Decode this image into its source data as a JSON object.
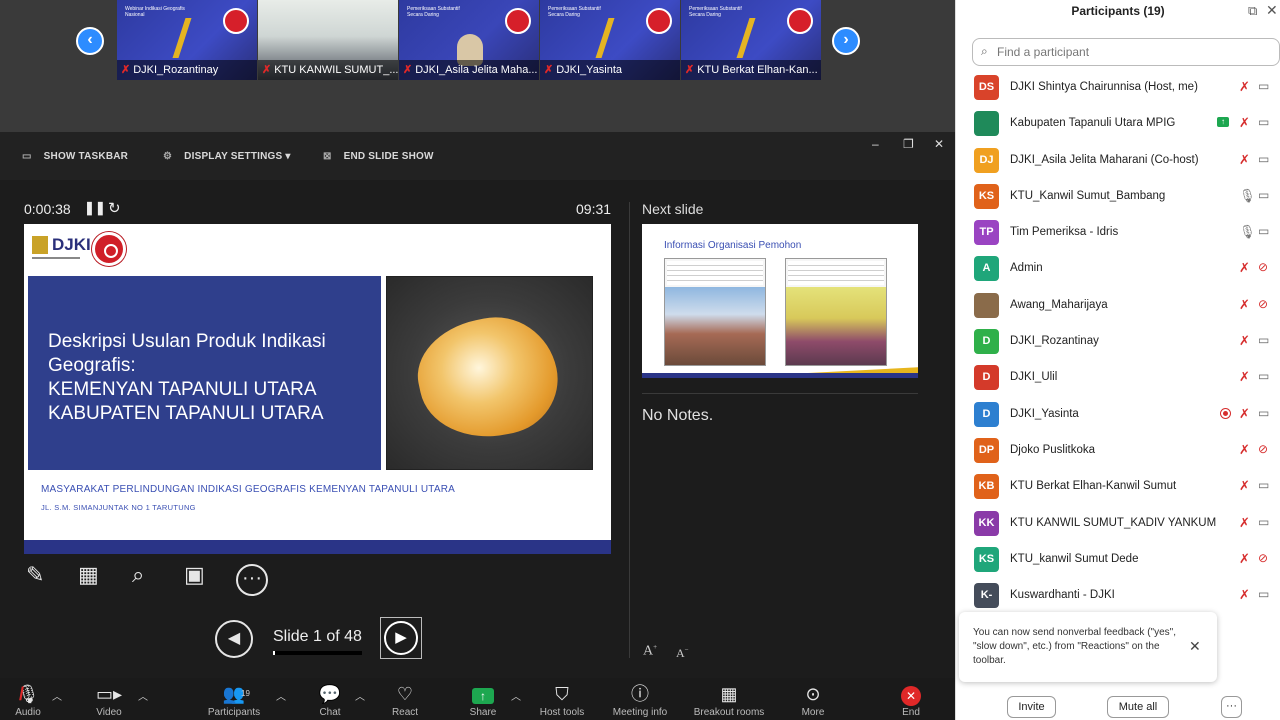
{
  "gallery": {
    "prev_icon": "‹",
    "next_icon": "›",
    "tiles": [
      {
        "name": "DJKI_Rozantinay",
        "kind": "slide",
        "caption": "Webinar Indikasi Geografis Nasional"
      },
      {
        "name": "KTU KANWIL SUMUT_...",
        "kind": "photo",
        "caption": ""
      },
      {
        "name": "DJKI_Asila Jelita Maha...",
        "kind": "person",
        "caption": "Pemeriksaan Substantif Secara Daring"
      },
      {
        "name": "DJKI_Yasinta",
        "kind": "slide",
        "caption": "Pemeriksaan Substantif Secara Daring"
      },
      {
        "name": "KTU Berkat Elhan-Kan...",
        "kind": "slide",
        "caption": "Pemeriksaan Substantif Secara Daring"
      }
    ]
  },
  "slideshow_toolbar": {
    "show_taskbar": "SHOW TASKBAR",
    "display_settings": "DISPLAY SETTINGS ▾",
    "end_slide_show": "END SLIDE SHOW"
  },
  "presenter": {
    "elapsed": "0:00:38",
    "clock": "09:31",
    "next_slide_label": "Next slide",
    "no_notes": "No Notes.",
    "slide_counter": "Slide 1 of 48",
    "progress_fraction": 0.0208
  },
  "slide": {
    "logo_text": "DJKI",
    "title_lines": [
      "Deskripsi Usulan Produk Indikasi",
      "Geografis:",
      "KEMENYAN TAPANULI UTARA",
      "KABUPATEN TAPANULI UTARA"
    ],
    "footer_line1": "MASYARAKAT PERLINDUNGAN INDIKASI GEOGRAFIS KEMENYAN TAPANULI UTARA",
    "footer_line2": "JL. S.M. SIMANJUNTAK NO 1 TARUTUNG"
  },
  "next_slide": {
    "title": "Informasi Organisasi Pemohon"
  },
  "bottom_toolbar": {
    "audio": "Audio",
    "video": "Video",
    "participants": "Participants",
    "participants_count": "19",
    "chat": "Chat",
    "react": "React",
    "share": "Share",
    "host_tools": "Host tools",
    "meeting_info": "Meeting info",
    "breakout_rooms": "Breakout rooms",
    "more": "More",
    "end": "End"
  },
  "panel": {
    "title": "Participants (19)",
    "search_placeholder": "Find a participant",
    "participants": [
      {
        "initials": "DS",
        "name": "DJKI Shintya Chairunnisa (Host, me)",
        "color": "#d9432a",
        "mic": "muted",
        "cam": "on"
      },
      {
        "initials": "",
        "name": "Kabupaten Tapanuli Utara MPIG",
        "color": "#1f8a5a",
        "mic": "muted",
        "cam": "on",
        "sharing": true
      },
      {
        "initials": "DJ",
        "name": "DJKI_Asila Jelita Maharani (Co-host)",
        "color": "#f0a020",
        "mic": "muted",
        "cam": "on"
      },
      {
        "initials": "KS",
        "name": "KTU_Kanwil Sumut_Bambang",
        "color": "#e0621a",
        "mic": "on",
        "cam": "on"
      },
      {
        "initials": "TP",
        "name": "Tim Pemeriksa - Idris",
        "color": "#9a44c2",
        "mic": "on",
        "cam": "on"
      },
      {
        "initials": "A",
        "name": "Admin",
        "color": "#1fa67a",
        "mic": "muted",
        "cam": "off"
      },
      {
        "initials": "",
        "name": "Awang_Maharijaya",
        "color": "#8a6b4a",
        "mic": "muted",
        "cam": "off"
      },
      {
        "initials": "D",
        "name": "DJKI_Rozantinay",
        "color": "#2fb04a",
        "mic": "muted",
        "cam": "on"
      },
      {
        "initials": "D",
        "name": "DJKI_Ulil",
        "color": "#d43a2a",
        "mic": "muted",
        "cam": "on"
      },
      {
        "initials": "D",
        "name": "DJKI_Yasinta",
        "color": "#2d7fd0",
        "mic": "muted",
        "cam": "on",
        "recording": true
      },
      {
        "initials": "DP",
        "name": "Djoko Puslitkoka",
        "color": "#e0621a",
        "mic": "muted",
        "cam": "off"
      },
      {
        "initials": "KB",
        "name": "KTU Berkat Elhan-Kanwil Sumut",
        "color": "#e0621a",
        "mic": "muted",
        "cam": "on"
      },
      {
        "initials": "KK",
        "name": "KTU KANWIL SUMUT_KADIV YANKUM",
        "color": "#8a3aa8",
        "mic": "muted",
        "cam": "on"
      },
      {
        "initials": "KS",
        "name": "KTU_kanwil Sumut Dede",
        "color": "#1fa67a",
        "mic": "muted",
        "cam": "off"
      },
      {
        "initials": "K-",
        "name": "Kuswardhanti - DJKI",
        "color": "#444c5a",
        "mic": "muted",
        "cam": "on"
      }
    ],
    "tip": "You can now send nonverbal feedback (\"yes\", \"slow down\", etc.) from \"Reactions\" on the toolbar.",
    "invite": "Invite",
    "mute_all": "Mute all",
    "more": "···"
  }
}
